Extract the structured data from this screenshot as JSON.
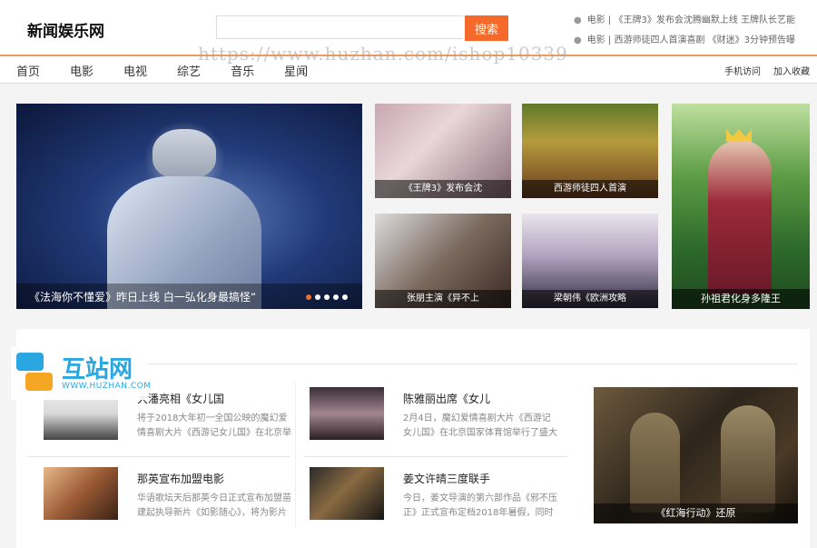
{
  "header": {
    "logo": "新闻娱乐网",
    "search": {
      "placeholder": "",
      "button": "搜索"
    },
    "ticker": [
      "电影 | 《王牌3》发布会沈腾幽默上线 王牌队长艺能",
      "电影 | 西游师徒四人首演喜剧 《财迷》3分钟预告曝"
    ]
  },
  "watermark": "https://www.huzhan.com/ishop10339",
  "nav": {
    "items": [
      "首页",
      "电影",
      "电视",
      "综艺",
      "音乐",
      "星闻"
    ],
    "right": [
      "手机访问",
      "加入收藏"
    ]
  },
  "slider": {
    "caption": "《法海你不懂爱》昨日上线 白一弘化身最搞怪“",
    "dot_count": 5,
    "active_dot": 1
  },
  "thumbs": [
    {
      "caption": "《王牌3》发布会沈"
    },
    {
      "caption": "西游师徒四人首演"
    },
    {
      "caption": "张朋主演《异不上"
    },
    {
      "caption": "梁朝伟《欧洲攻略"
    },
    {
      "caption": "孙祖君化身多隆王"
    }
  ],
  "section": {
    "title": "",
    "items": [
      {
        "title": "大潘亮相《女儿国",
        "desc": "将于2018大年初一全国公映的魔幻爱情喜剧大片《西游记女儿国》在北京举"
      },
      {
        "title": "陈雅丽出席《女儿",
        "desc": "2月4日，魔幻爱情喜剧大片《西游记女儿国》在北京国家体育馆举行了盛大"
      },
      {
        "title": "那英宣布加盟电影",
        "desc": "华语歌坛天后那英今日正式宣布加盟苗建起执导新片《如影随心》，将为影片"
      },
      {
        "title": "姜文许晴三度联手",
        "desc": "今日，姜文导演的第六部作品《邪不压正》正式宣布定档2018年暑假，同时"
      }
    ],
    "feature": {
      "caption": "《红海行动》还原"
    }
  },
  "badge": {
    "name": "互站网",
    "url": "WWW.HUZHAN.COM"
  }
}
